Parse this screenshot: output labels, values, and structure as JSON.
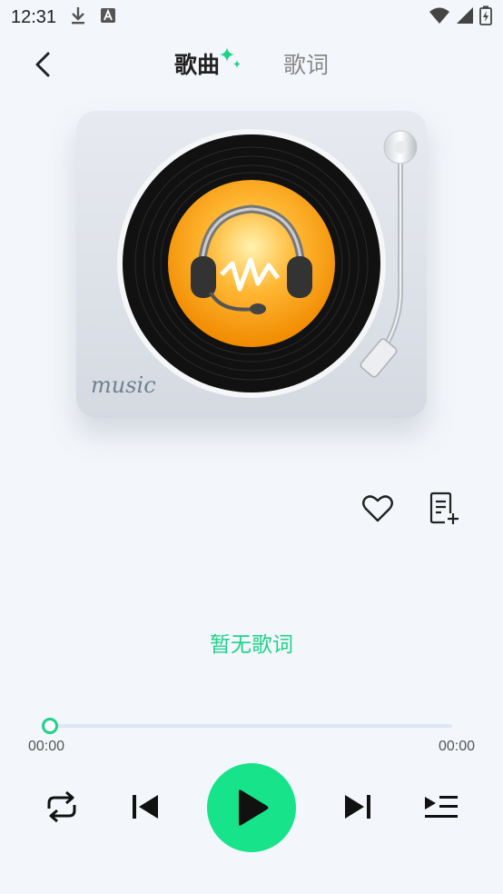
{
  "status_bar": {
    "time": "12:31",
    "icons": [
      "download-icon",
      "notification-a-icon",
      "wifi-icon",
      "signal-icon",
      "battery-charging-icon"
    ]
  },
  "header": {
    "tabs": [
      {
        "label": "歌曲",
        "active": true
      },
      {
        "label": "歌词",
        "active": false
      }
    ]
  },
  "turntable": {
    "script_text": "music"
  },
  "actions": {
    "like_icon": "heart-icon",
    "add_to_playlist_icon": "add-list-icon"
  },
  "lyrics": {
    "empty_text": "暂无歌词"
  },
  "progress": {
    "current_time": "00:00",
    "total_time": "00:00",
    "fraction": 0
  },
  "colors": {
    "accent": "#1fd28a",
    "play_button": "#16e38a",
    "background": "#f3f6fa"
  }
}
